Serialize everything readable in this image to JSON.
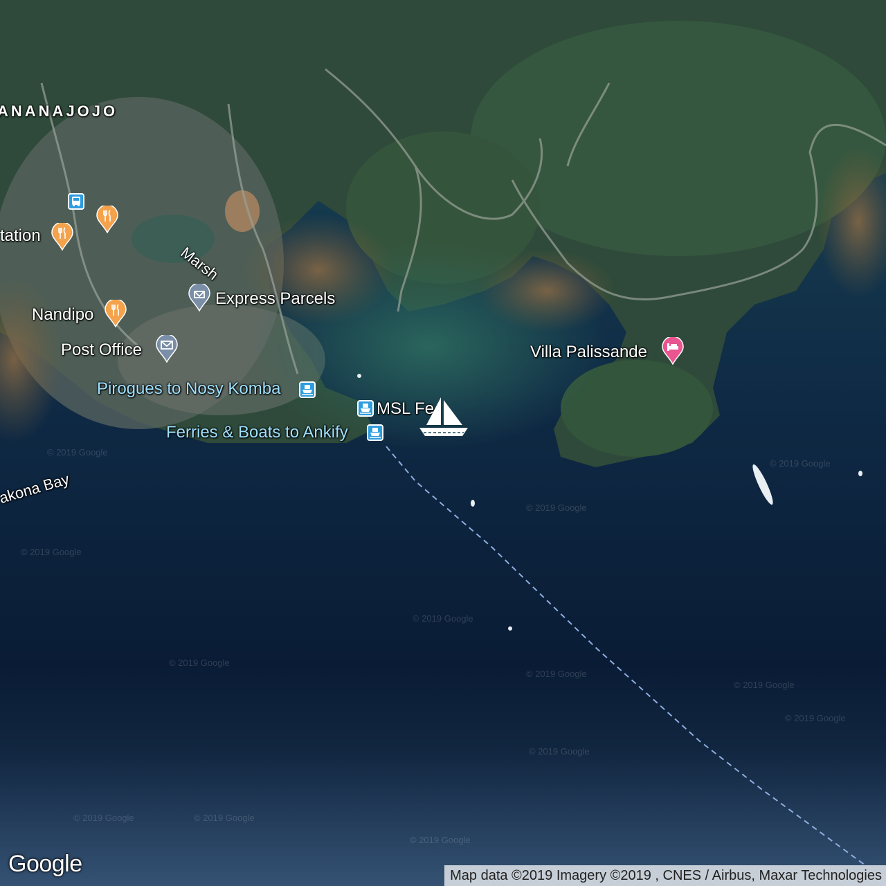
{
  "map": {
    "town_label": "ANANAJOJO",
    "places": {
      "station": "tation",
      "marsh": "Marsh",
      "express_parcels": "Express Parcels",
      "nandipo": "Nandipo",
      "post_office": "Post Office",
      "pirogues": "Pirogues to Nosy Komba",
      "msl_ferry": "MSL Fe",
      "ferries_boats": "Ferries & Boats to Ankify",
      "villa": "Villa Palissande",
      "bay": "akona Bay"
    },
    "icons": {
      "bus": "bus-stop-icon",
      "restaurant": "restaurant-icon",
      "parcel": "parcel-pin-icon",
      "post": "mail-pin-icon",
      "ferry": "ferry-icon",
      "hotel": "hotel-pin-icon",
      "sailboat": "sailboat-icon"
    },
    "colors": {
      "restaurant": "#f4a24c",
      "transit": "#2e9dde",
      "hotel": "#e8558f",
      "info": "#7a8ea8",
      "ferry_route": "#8eaee0"
    },
    "watermark": "© 2019 Google"
  },
  "attribution": "Map data ©2019  Imagery ©2019 , CNES / Airbus, Maxar Technologies",
  "logo": "Google"
}
